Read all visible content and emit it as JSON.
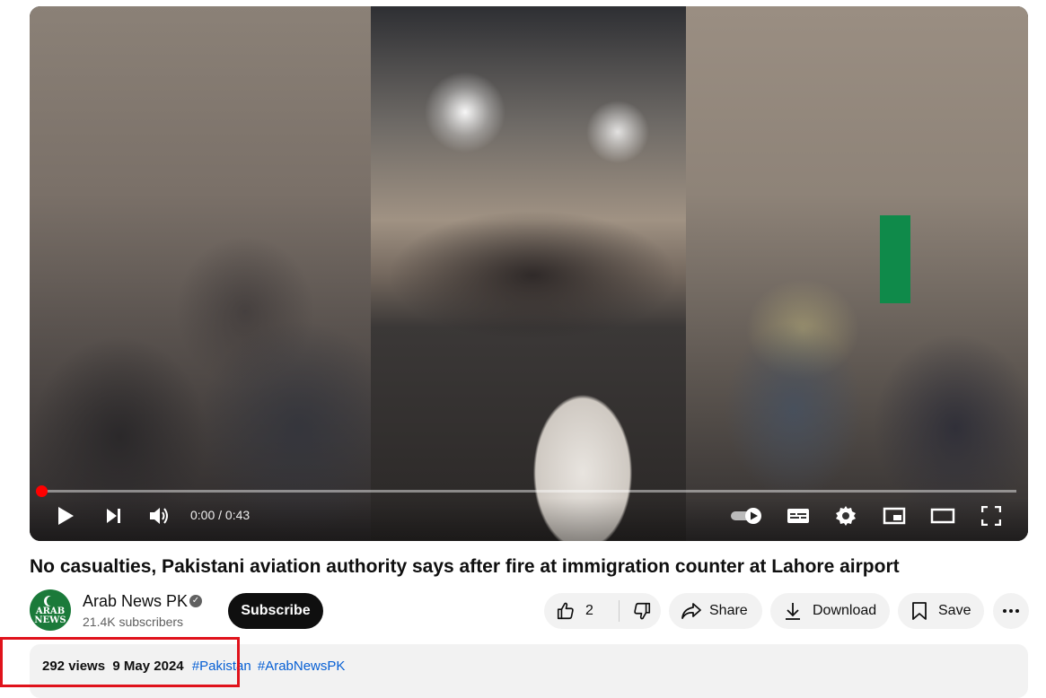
{
  "player": {
    "time_display": "0:00 / 0:43",
    "progress_fraction": 0,
    "controls": {
      "play": "play-icon",
      "next": "next-icon",
      "volume": "volume-icon",
      "autoplay": "autoplay-toggle-icon",
      "subtitles": "subtitles-icon",
      "settings": "settings-icon",
      "miniplayer": "miniplayer-icon",
      "theater": "theater-icon",
      "fullscreen": "fullscreen-icon"
    }
  },
  "video": {
    "title": "No casualties, Pakistani aviation authority says after fire at immigration counter at Lahore airport"
  },
  "channel": {
    "avatar_text_line1": "ARAB",
    "avatar_text_line2": "NEWS",
    "name": "Arab News PK",
    "verified_mark": "✓",
    "subscribers": "21.4K subscribers",
    "subscribe_label": "Subscribe"
  },
  "actions": {
    "like_count": "2",
    "share_label": "Share",
    "download_label": "Download",
    "save_label": "Save"
  },
  "description": {
    "views": "292 views",
    "date": "9 May 2024",
    "hashtags": [
      "#Pakistan",
      "#ArabNewsPK"
    ]
  },
  "colors": {
    "annotation_box": "#e0121b",
    "progress": "#ff0000",
    "link": "#065fd4"
  }
}
